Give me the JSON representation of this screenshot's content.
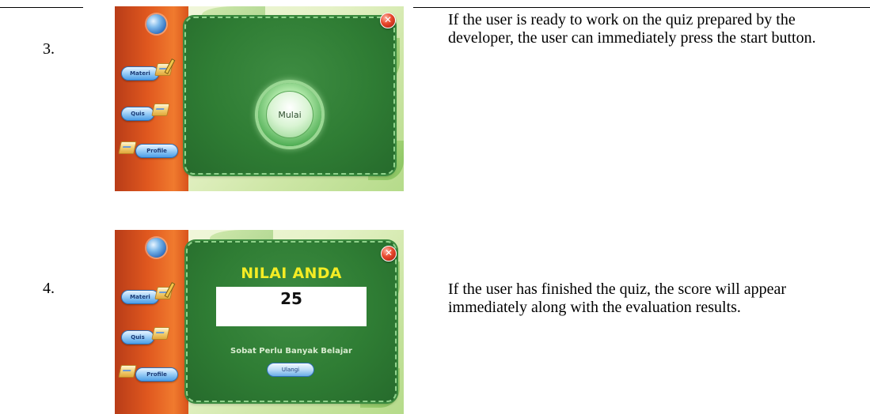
{
  "rows": [
    {
      "number": "3.",
      "description": "If the user is ready to work on the quiz prepared by the developer, the user can immediately press the start button.",
      "screen": {
        "sidebar": {
          "materi_label": "Materi",
          "quiz_label": "Quis",
          "profile_label": "Profile"
        },
        "close_icon": "close-icon",
        "start_button_label": "Mulai"
      }
    },
    {
      "number": "4.",
      "description": "If the user has finished the quiz, the score will appear immediately along with the evaluation results.",
      "screen": {
        "sidebar": {
          "materi_label": "Materi",
          "quiz_label": "Quis",
          "profile_label": "Profile"
        },
        "close_icon": "close-icon",
        "score_title": "NILAI ANDA",
        "score_value": "25",
        "evaluation_text": "Sobat Perlu Banyak Belajar",
        "retry_button_label": "Ulangi"
      }
    }
  ],
  "colors": {
    "sidebar_orange": "#e0581f",
    "panel_green": "#2f7d34",
    "title_yellow": "#f4ec24",
    "close_red": "#e8462b"
  }
}
